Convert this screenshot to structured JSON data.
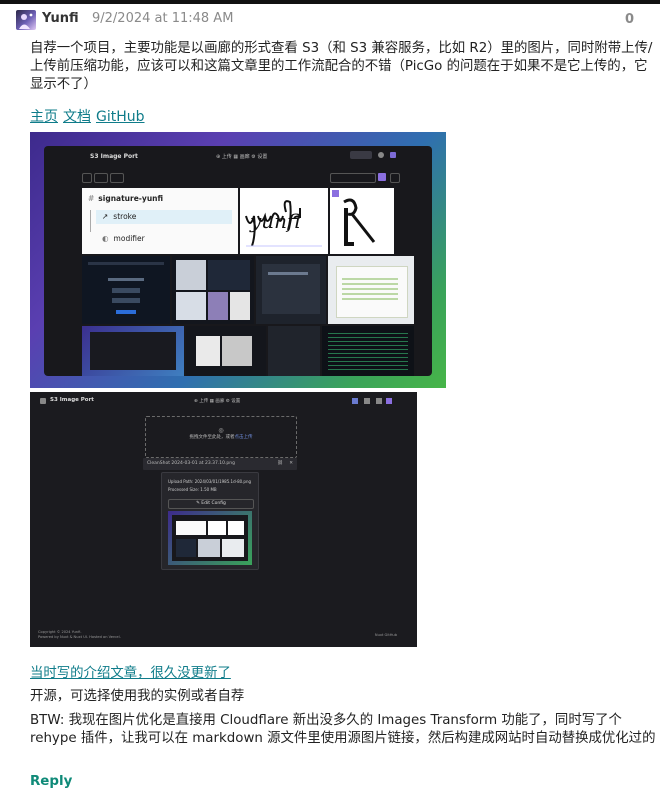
{
  "post": {
    "author": "Yunfi",
    "timestamp": "9/2/2024 at 11:48 AM",
    "score": "0",
    "paragraph1": "自荐一个项目，主要功能是以画廊的形式查看 S3（和 S3 兼容服务，比如 R2）里的图片，同时附带上传/上传前压缩功能，应该可以和这篇文章里的工作流配合的不错（PicGo 的问题在于如果不是它上传的，它显示不了）",
    "links": [
      "主页",
      "文档",
      "GitHub"
    ],
    "article_link": "当时写的介绍文章，很久没更新了",
    "paragraph2": "开源，可选择使用我的实例或者自荐",
    "paragraph3": "BTW: 我现在图片优化是直接用 Cloudflare 新出没多久的 Images Transform 功能了，同时写了个 rehype 插件，让我可以在 markdown 源文件里使用源图片链接，然后构建成网站时自动替换成优化过的",
    "reply_label": "Reply"
  },
  "screenshot1": {
    "app_title": "S3 Image Port",
    "nav": "⊕ 上传  ▦ 画廊  ⚙ 设置",
    "folder_name": "signature-yunfi",
    "items": [
      "stroke",
      "modifier"
    ],
    "signature_text": "yunfi"
  },
  "screenshot2": {
    "app_title": "S3 Image Port",
    "nav": "⊕ 上传  ▦ 画廊  ⚙ 设置",
    "dropzone_text": "拖拽文件至此处，或者",
    "dropzone_link": "点击上传",
    "file_name": "CleanShot 2024-03-01 at 23.37.10.png",
    "upload_path": "Upload Path: 2024/03/01/1985.1d-80.png",
    "processed_size": "Processed Size: 1.50 MB",
    "edit_config": "Edit Config",
    "footer_line1": "Copyright © 2024 Yunfi.",
    "footer_line2": "Powered by Nuxt & Nuxt UI. Hosted on Vercel.",
    "footer_right": "Nuxt     GitHub"
  },
  "colors": {
    "link": "#0f7c8a",
    "reply": "#0f8a78",
    "muted": "#8a8a8a"
  }
}
